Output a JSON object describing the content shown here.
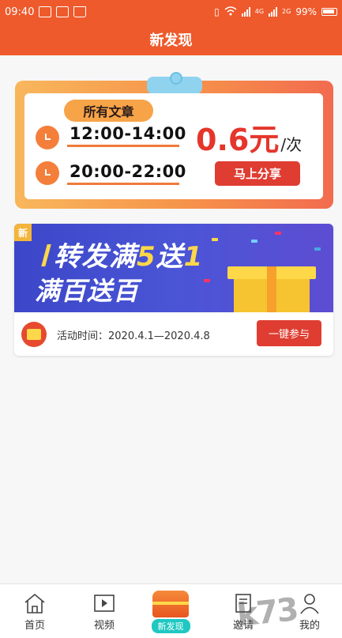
{
  "status_bar": {
    "time": "09:40",
    "network1": "4G",
    "network2": "2G",
    "battery": "99%"
  },
  "header": {
    "title": "新发现"
  },
  "promo": {
    "pill": "所有文章",
    "slot1": "12:00-14:00",
    "slot2": "20:00-22:00",
    "price_value": "0.6元",
    "price_unit": "/次",
    "share_label": "马上分享"
  },
  "activity": {
    "new_tag": "新",
    "banner_line1_a": "转发满",
    "banner_line1_b": "5",
    "banner_line1_c": "送",
    "banner_line1_d": "1",
    "banner_line2": "满百送百",
    "time_label": "活动时间：2020.4.1—2020.4.8",
    "join_label": "一键参与"
  },
  "nav": {
    "home": "首页",
    "video": "视频",
    "discover": "新发现",
    "invite": "邀请",
    "mine": "我的"
  },
  "watermark": "k73"
}
